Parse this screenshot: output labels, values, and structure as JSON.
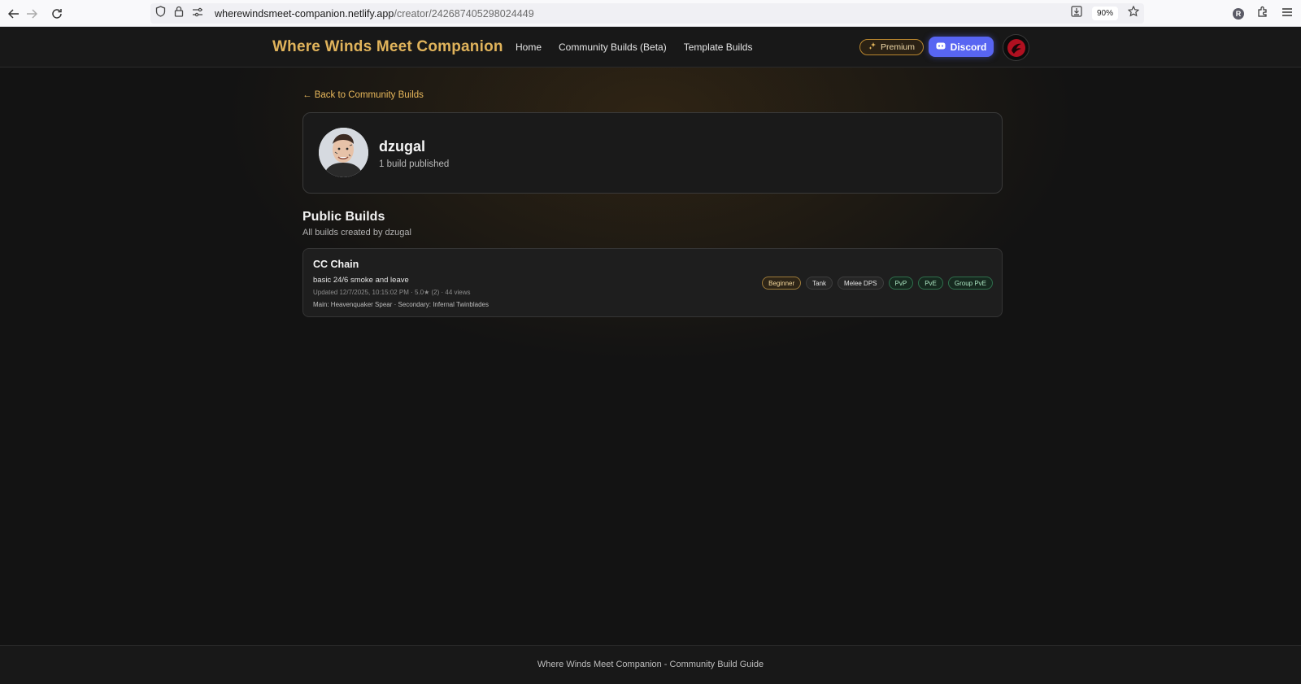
{
  "browser": {
    "url_host": "wherewindsmeet-companion.netlify.app",
    "url_path": "/creator/242687405298024449",
    "zoom": "90%",
    "account_initial": "R"
  },
  "header": {
    "title": "Where Winds Meet Companion",
    "nav": [
      "Home",
      "Community Builds (Beta)",
      "Template Builds"
    ],
    "premium_label": "Premium",
    "discord_label": "Discord"
  },
  "back_link": "← Back to Community Builds",
  "profile": {
    "name": "dzugal",
    "count": "1 build published"
  },
  "section": {
    "title": "Public Builds",
    "subtitle": "All builds created by dzugal"
  },
  "builds": [
    {
      "name": "CC Chain",
      "description": "basic 24/6 smoke and leave",
      "meta": "Updated 12/7/2025, 10:15:02 PM · 5.0★ (2) · 44 views",
      "weapons": "Main: Heavenquaker Spear · Secondary: Infernal Twinblades",
      "tags": [
        "Beginner",
        "Tank",
        "Melee DPS",
        "PvP",
        "PvE",
        "Group PvE"
      ]
    }
  ],
  "footer": "Where Winds Meet Companion - Community Build Guide",
  "colors": {
    "accent_gold": "#e0b35b",
    "discord": "#5865f2",
    "background": "#131313"
  }
}
